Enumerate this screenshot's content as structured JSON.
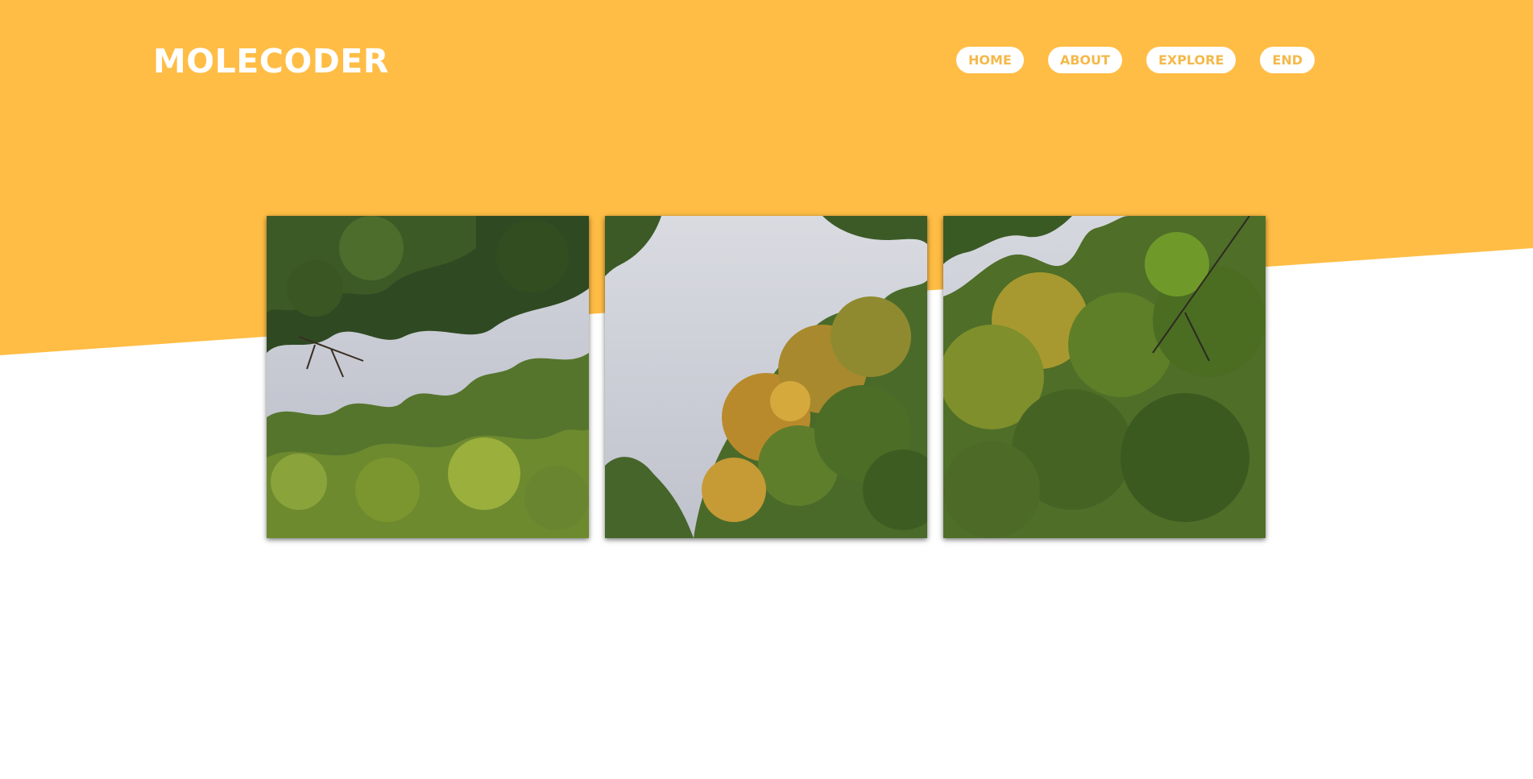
{
  "colors": {
    "accent": "#ffbd45",
    "nav_text": "#f4b94a",
    "background": "#ffffff",
    "sky": "#c9ccd6",
    "leaf_dark": "#2f4a22",
    "leaf_mid": "#56752c",
    "leaf_light": "#8aa33a",
    "leaf_autumn": "#c9952f"
  },
  "header": {
    "logo": "MOLECODER"
  },
  "nav": {
    "items": [
      {
        "label": "HOME"
      },
      {
        "label": "ABOUT"
      },
      {
        "label": "EXPLORE"
      },
      {
        "label": "END"
      }
    ]
  },
  "gallery": {
    "images": [
      {
        "icon": "tree-canopy-photo"
      },
      {
        "icon": "autumn-tree-canopy-photo"
      },
      {
        "icon": "green-tree-canopy-photo"
      }
    ]
  }
}
